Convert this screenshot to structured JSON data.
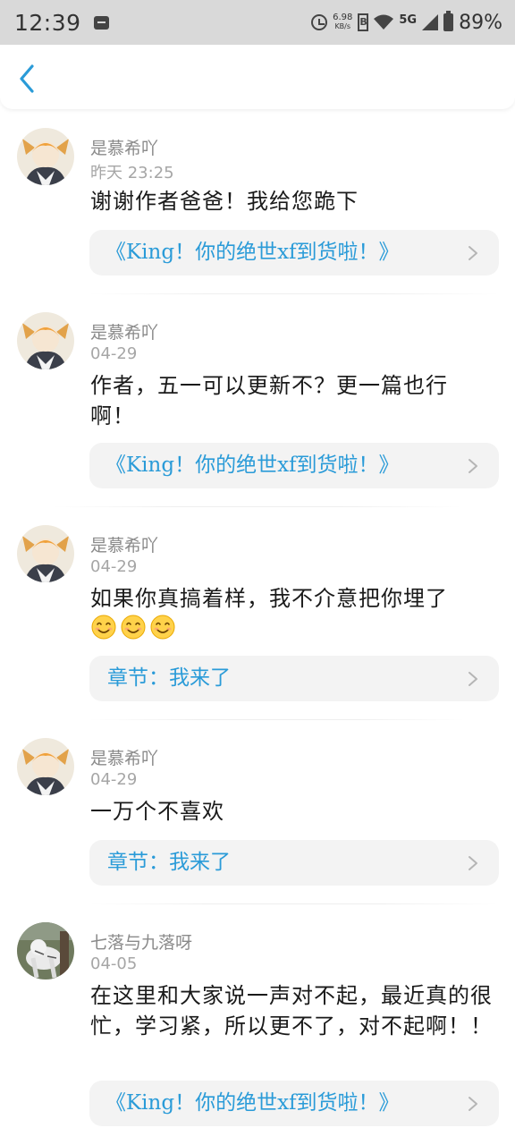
{
  "status_bar": {
    "time": "12:39",
    "net_speed_value": "6.98",
    "net_speed_unit": "KB/s",
    "network_type": "5G",
    "battery": "89%"
  },
  "header": {
    "back_icon": "chevron-left-icon",
    "accent_color": "#2a9bd8"
  },
  "comments": [
    {
      "username": "是慕希吖",
      "timestamp": "昨天 23:25",
      "text": "谢谢作者爸爸！我给您跪下",
      "link": "《King！你的绝世xf到货啦！》"
    },
    {
      "username": "是慕希吖",
      "timestamp": "04-29",
      "text": "作者，五一可以更新不？更一篇也行啊！",
      "link": "《King！你的绝世xf到货啦！》"
    },
    {
      "username": "是慕希吖",
      "timestamp": "04-29",
      "text": "如果你真搞着样，我不介意把你埋了",
      "emoji": "😊😊😊",
      "link": "章节：我来了"
    },
    {
      "username": "是慕希吖",
      "timestamp": "04-29",
      "text": "一万个不喜欢",
      "link": "章节：我来了"
    },
    {
      "username": "七落与九落呀",
      "timestamp": "04-05",
      "text": "在这里和大家说一声对不起，最近真的很忙，学习紧，所以更不了，对不起啊！！",
      "link": "《King！你的绝世xf到货啦！》"
    }
  ]
}
